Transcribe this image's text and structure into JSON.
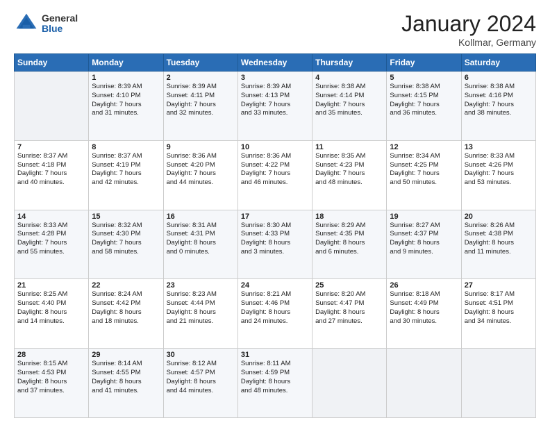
{
  "header": {
    "logo_general": "General",
    "logo_blue": "Blue",
    "title": "January 2024",
    "subtitle": "Kollmar, Germany"
  },
  "days_of_week": [
    "Sunday",
    "Monday",
    "Tuesday",
    "Wednesday",
    "Thursday",
    "Friday",
    "Saturday"
  ],
  "weeks": [
    [
      {
        "day": "",
        "sunrise": "",
        "sunset": "",
        "daylight": "",
        "empty": true
      },
      {
        "day": "1",
        "sunrise": "Sunrise: 8:39 AM",
        "sunset": "Sunset: 4:10 PM",
        "daylight": "Daylight: 7 hours and 31 minutes."
      },
      {
        "day": "2",
        "sunrise": "Sunrise: 8:39 AM",
        "sunset": "Sunset: 4:11 PM",
        "daylight": "Daylight: 7 hours and 32 minutes."
      },
      {
        "day": "3",
        "sunrise": "Sunrise: 8:39 AM",
        "sunset": "Sunset: 4:13 PM",
        "daylight": "Daylight: 7 hours and 33 minutes."
      },
      {
        "day": "4",
        "sunrise": "Sunrise: 8:38 AM",
        "sunset": "Sunset: 4:14 PM",
        "daylight": "Daylight: 7 hours and 35 minutes."
      },
      {
        "day": "5",
        "sunrise": "Sunrise: 8:38 AM",
        "sunset": "Sunset: 4:15 PM",
        "daylight": "Daylight: 7 hours and 36 minutes."
      },
      {
        "day": "6",
        "sunrise": "Sunrise: 8:38 AM",
        "sunset": "Sunset: 4:16 PM",
        "daylight": "Daylight: 7 hours and 38 minutes."
      }
    ],
    [
      {
        "day": "7",
        "sunrise": "Sunrise: 8:37 AM",
        "sunset": "Sunset: 4:18 PM",
        "daylight": "Daylight: 7 hours and 40 minutes."
      },
      {
        "day": "8",
        "sunrise": "Sunrise: 8:37 AM",
        "sunset": "Sunset: 4:19 PM",
        "daylight": "Daylight: 7 hours and 42 minutes."
      },
      {
        "day": "9",
        "sunrise": "Sunrise: 8:36 AM",
        "sunset": "Sunset: 4:20 PM",
        "daylight": "Daylight: 7 hours and 44 minutes."
      },
      {
        "day": "10",
        "sunrise": "Sunrise: 8:36 AM",
        "sunset": "Sunset: 4:22 PM",
        "daylight": "Daylight: 7 hours and 46 minutes."
      },
      {
        "day": "11",
        "sunrise": "Sunrise: 8:35 AM",
        "sunset": "Sunset: 4:23 PM",
        "daylight": "Daylight: 7 hours and 48 minutes."
      },
      {
        "day": "12",
        "sunrise": "Sunrise: 8:34 AM",
        "sunset": "Sunset: 4:25 PM",
        "daylight": "Daylight: 7 hours and 50 minutes."
      },
      {
        "day": "13",
        "sunrise": "Sunrise: 8:33 AM",
        "sunset": "Sunset: 4:26 PM",
        "daylight": "Daylight: 7 hours and 53 minutes."
      }
    ],
    [
      {
        "day": "14",
        "sunrise": "Sunrise: 8:33 AM",
        "sunset": "Sunset: 4:28 PM",
        "daylight": "Daylight: 7 hours and 55 minutes."
      },
      {
        "day": "15",
        "sunrise": "Sunrise: 8:32 AM",
        "sunset": "Sunset: 4:30 PM",
        "daylight": "Daylight: 7 hours and 58 minutes."
      },
      {
        "day": "16",
        "sunrise": "Sunrise: 8:31 AM",
        "sunset": "Sunset: 4:31 PM",
        "daylight": "Daylight: 8 hours and 0 minutes."
      },
      {
        "day": "17",
        "sunrise": "Sunrise: 8:30 AM",
        "sunset": "Sunset: 4:33 PM",
        "daylight": "Daylight: 8 hours and 3 minutes."
      },
      {
        "day": "18",
        "sunrise": "Sunrise: 8:29 AM",
        "sunset": "Sunset: 4:35 PM",
        "daylight": "Daylight: 8 hours and 6 minutes."
      },
      {
        "day": "19",
        "sunrise": "Sunrise: 8:27 AM",
        "sunset": "Sunset: 4:37 PM",
        "daylight": "Daylight: 8 hours and 9 minutes."
      },
      {
        "day": "20",
        "sunrise": "Sunrise: 8:26 AM",
        "sunset": "Sunset: 4:38 PM",
        "daylight": "Daylight: 8 hours and 11 minutes."
      }
    ],
    [
      {
        "day": "21",
        "sunrise": "Sunrise: 8:25 AM",
        "sunset": "Sunset: 4:40 PM",
        "daylight": "Daylight: 8 hours and 14 minutes."
      },
      {
        "day": "22",
        "sunrise": "Sunrise: 8:24 AM",
        "sunset": "Sunset: 4:42 PM",
        "daylight": "Daylight: 8 hours and 18 minutes."
      },
      {
        "day": "23",
        "sunrise": "Sunrise: 8:23 AM",
        "sunset": "Sunset: 4:44 PM",
        "daylight": "Daylight: 8 hours and 21 minutes."
      },
      {
        "day": "24",
        "sunrise": "Sunrise: 8:21 AM",
        "sunset": "Sunset: 4:46 PM",
        "daylight": "Daylight: 8 hours and 24 minutes."
      },
      {
        "day": "25",
        "sunrise": "Sunrise: 8:20 AM",
        "sunset": "Sunset: 4:47 PM",
        "daylight": "Daylight: 8 hours and 27 minutes."
      },
      {
        "day": "26",
        "sunrise": "Sunrise: 8:18 AM",
        "sunset": "Sunset: 4:49 PM",
        "daylight": "Daylight: 8 hours and 30 minutes."
      },
      {
        "day": "27",
        "sunrise": "Sunrise: 8:17 AM",
        "sunset": "Sunset: 4:51 PM",
        "daylight": "Daylight: 8 hours and 34 minutes."
      }
    ],
    [
      {
        "day": "28",
        "sunrise": "Sunrise: 8:15 AM",
        "sunset": "Sunset: 4:53 PM",
        "daylight": "Daylight: 8 hours and 37 minutes."
      },
      {
        "day": "29",
        "sunrise": "Sunrise: 8:14 AM",
        "sunset": "Sunset: 4:55 PM",
        "daylight": "Daylight: 8 hours and 41 minutes."
      },
      {
        "day": "30",
        "sunrise": "Sunrise: 8:12 AM",
        "sunset": "Sunset: 4:57 PM",
        "daylight": "Daylight: 8 hours and 44 minutes."
      },
      {
        "day": "31",
        "sunrise": "Sunrise: 8:11 AM",
        "sunset": "Sunset: 4:59 PM",
        "daylight": "Daylight: 8 hours and 48 minutes."
      },
      {
        "day": "",
        "sunrise": "",
        "sunset": "",
        "daylight": "",
        "empty": true
      },
      {
        "day": "",
        "sunrise": "",
        "sunset": "",
        "daylight": "",
        "empty": true
      },
      {
        "day": "",
        "sunrise": "",
        "sunset": "",
        "daylight": "",
        "empty": true
      }
    ]
  ]
}
